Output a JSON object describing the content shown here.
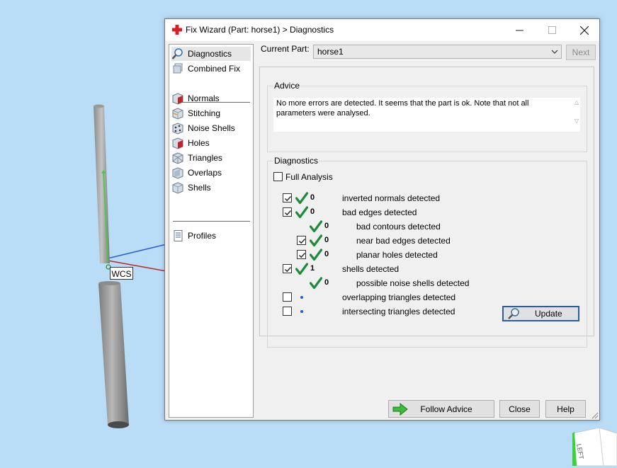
{
  "window": {
    "title": "Fix Wizard (Part: horse1) > Diagnostics"
  },
  "viewport": {
    "wcs_label": "WCS",
    "navcube_label": "LEFT"
  },
  "sidebar": {
    "items": [
      {
        "label": "Diagnostics",
        "icon": "magnifier-icon",
        "selected": true
      },
      {
        "label": "Combined Fix",
        "icon": "stack-icon"
      },
      {
        "label": "Normals",
        "icon": "normals-cube-icon"
      },
      {
        "label": "Stitching",
        "icon": "stitching-cube-icon"
      },
      {
        "label": "Noise Shells",
        "icon": "noise-shells-icon"
      },
      {
        "label": "Holes",
        "icon": "holes-cube-icon"
      },
      {
        "label": "Triangles",
        "icon": "triangles-cube-icon"
      },
      {
        "label": "Overlaps",
        "icon": "overlaps-cube-icon"
      },
      {
        "label": "Shells",
        "icon": "shells-cube-icon"
      },
      {
        "label": "Profiles",
        "icon": "profiles-document-icon"
      }
    ]
  },
  "current_part": {
    "label": "Current Part:",
    "value": "horse1",
    "next_label": "Next"
  },
  "advice": {
    "title": "Advice",
    "text": "No more errors are detected. It seems that the part is ok. Note that not all parameters were analysed."
  },
  "diagnostics": {
    "title": "Diagnostics",
    "full_analysis_label": "Full Analysis",
    "full_analysis_checked": false,
    "rows": [
      {
        "count": "0",
        "label": "inverted normals detected",
        "checkbox": true,
        "checked": true,
        "status": "ok",
        "indent": 0
      },
      {
        "count": "0",
        "label": "bad edges detected",
        "checkbox": true,
        "checked": true,
        "status": "ok",
        "indent": 0
      },
      {
        "count": "0",
        "label": "bad contours detected",
        "checkbox": false,
        "checked": false,
        "status": "ok",
        "indent": 1
      },
      {
        "count": "0",
        "label": "near bad edges detected",
        "checkbox": true,
        "checked": true,
        "status": "ok",
        "indent": 1
      },
      {
        "count": "0",
        "label": "planar holes detected",
        "checkbox": true,
        "checked": true,
        "status": "ok",
        "indent": 1
      },
      {
        "count": "1",
        "label": "shells detected",
        "checkbox": true,
        "checked": true,
        "status": "ok",
        "indent": 0
      },
      {
        "count": "0",
        "label": "possible noise shells detected",
        "checkbox": false,
        "checked": false,
        "status": "ok",
        "indent": 1
      },
      {
        "count": "",
        "label": "overlapping triangles detected",
        "checkbox": true,
        "checked": false,
        "status": "pending",
        "indent": 0
      },
      {
        "count": "",
        "label": "intersecting triangles detected",
        "checkbox": true,
        "checked": false,
        "status": "pending",
        "indent": 0
      }
    ],
    "update_label": "Update"
  },
  "footer": {
    "follow_advice_label": "Follow Advice",
    "close_label": "Close",
    "help_label": "Help"
  },
  "colors": {
    "ok_tick": "#1f8a3b",
    "pending_dot": "#1e5fc8",
    "desktop": "#b9dcf7",
    "accent_border": "#2a5da6"
  }
}
